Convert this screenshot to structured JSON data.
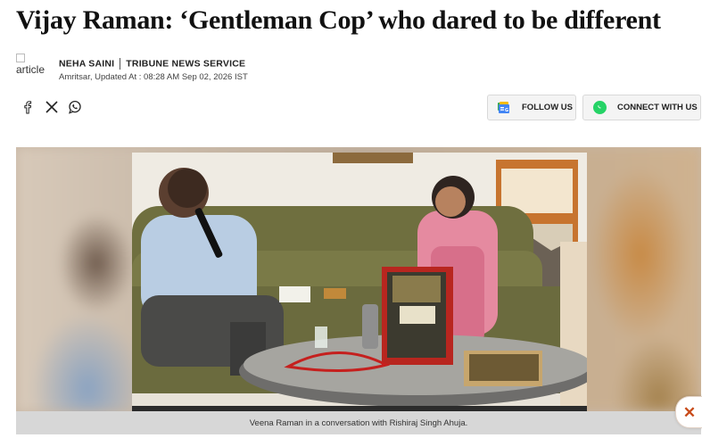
{
  "article": {
    "headline": "Vijay Raman: ‘Gentleman Cop’ who dared to be different",
    "author_image_alt": "article",
    "author": "NEHA SAINI",
    "source": "TRIBUNE NEWS SERVICE",
    "dateline": "Amritsar, Updated At : 08:28 AM Sep 02, 2026 IST"
  },
  "share": {
    "icons": [
      "facebook-icon",
      "x-icon",
      "whatsapp-icon"
    ]
  },
  "actions": {
    "follow_label": "FOLLOW US",
    "connect_label": "CONNECT WITH US"
  },
  "media": {
    "caption": "Veena Raman in a conversation with Rishiraj Singh Ahuja."
  },
  "close_label": "✕",
  "colors": {
    "whatsapp": "#25d366",
    "close": "#c84b1a",
    "caption_bg": "#d7d7d7"
  }
}
